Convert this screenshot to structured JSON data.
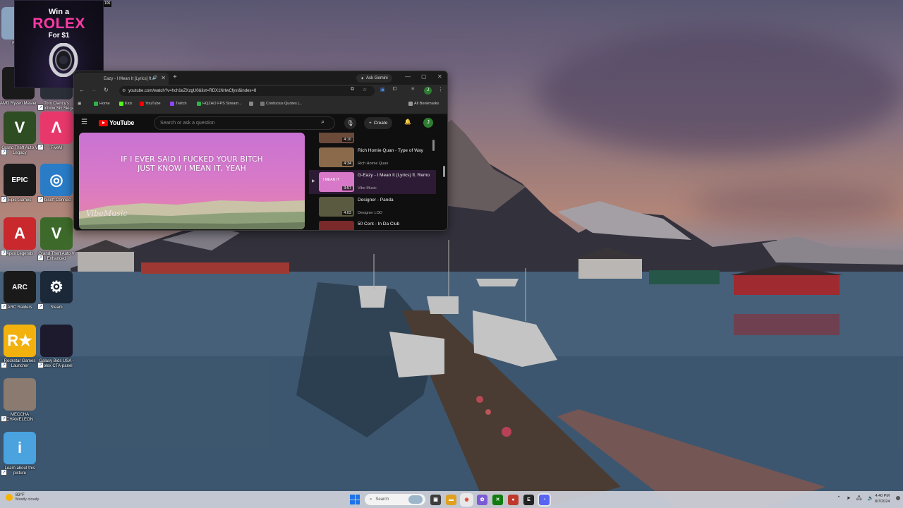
{
  "ad": {
    "line1": "Win a",
    "line2": "ROLEX",
    "line3": "For $1"
  },
  "topstrip": "106",
  "desktop_icons": [
    {
      "label": "Rec...",
      "color": "#8aa4c0",
      "glyph": ""
    },
    {
      "label": "AMD Ryzen Master",
      "color": "#1a1a1a",
      "glyph": ""
    },
    {
      "label": "Tom Clancy's Rainbow Six Siege",
      "color": "#2b2f38",
      "glyph": ""
    },
    {
      "label": "Grand Theft Auto V Legacy",
      "color": "#2e4d22",
      "glyph": "V"
    },
    {
      "label": "FiveM",
      "color": "#e8386b",
      "glyph": "Λ"
    },
    {
      "label": "Epic Games",
      "color": "#1a1a1a",
      "glyph": "EPIC"
    },
    {
      "label": "Ubisoft Connect",
      "color": "#2a7cc7",
      "glyph": "◎"
    },
    {
      "label": "Apex Legends",
      "color": "#c9282d",
      "glyph": "A"
    },
    {
      "label": "Grand Theft Auto V Enhanced",
      "color": "#3d6a2a",
      "glyph": "V"
    },
    {
      "label": "ARC Raiders",
      "color": "#1a1a1a",
      "glyph": "ARC"
    },
    {
      "label": "Steam",
      "color": "#1b2838",
      "glyph": "⚙"
    },
    {
      "label": "Rockstar Games Launcher",
      "color": "#f2b10d",
      "glyph": "R★"
    },
    {
      "label": "Galaxy Bids USA - Rolex CTA-panel",
      "color": "#1d1a2e",
      "glyph": ""
    },
    {
      "label": "MECCHA CHAMELEON",
      "color": "#8a7a70",
      "glyph": ""
    },
    {
      "label": "Learn about this picture",
      "color": "#4aa3df",
      "glyph": "i"
    }
  ],
  "browser": {
    "tab_title": "Eazy - I Mean It [Lyrics] ft.",
    "ask_gemini": "Ask Gemini",
    "url": "youtube.com/watch?v=hch1eZXzgU0&list=RDX1NrlwCfyxI&index=8",
    "bookmarks": [
      "Home",
      "Kick",
      "YouTube",
      "Twitch",
      "HQZAO FPS Stream...",
      "",
      "Confucius Quotes |...",
      "All Bookmarks"
    ],
    "bookmark_colors": [
      "#2db34a",
      "#53fc18",
      "#ff0000",
      "#9146ff",
      "#2db34a",
      "#888888",
      "#777777",
      "#999999"
    ]
  },
  "youtube": {
    "logo": "YouTube",
    "search_placeholder": "Search or ask a question",
    "create_label": "Create",
    "avatar": "J",
    "lyrics": "IF I EVER SAID I FUCKED YOUR BITCH\nJUST KNOW I MEAN IT, YEAH",
    "video_brand": "VibeMusic",
    "playlist": [
      {
        "title": "",
        "artist": "",
        "duration": "4:10",
        "thumb": "#6b4a3a",
        "active": false,
        "partial": true
      },
      {
        "title": "Rich Homie Quan - Type of Way",
        "artist": "Rich Homie Quan",
        "duration": "4:34",
        "thumb": "#8a6a4a",
        "active": false
      },
      {
        "title": "G-Eazy - I Mean It (Lyrics) ft. Remo",
        "artist": "Vibe Music",
        "duration": "3:57",
        "thumb": "#d878c8",
        "thumb_text": "I MEAN IT",
        "active": true
      },
      {
        "title": "Designer - Panda",
        "artist": "Designer LOD",
        "duration": "4:03",
        "thumb": "#5a5a40",
        "active": false
      },
      {
        "title": "50 Cent - In Da Club",
        "artist": "",
        "duration": "",
        "thumb": "#7a2a2a",
        "active": false
      }
    ]
  },
  "taskbar": {
    "weather_temp": "83°F",
    "weather_desc": "Mostly cloudy",
    "search_label": "Search",
    "time": "4:40 PM",
    "date": "8/7/2024"
  }
}
